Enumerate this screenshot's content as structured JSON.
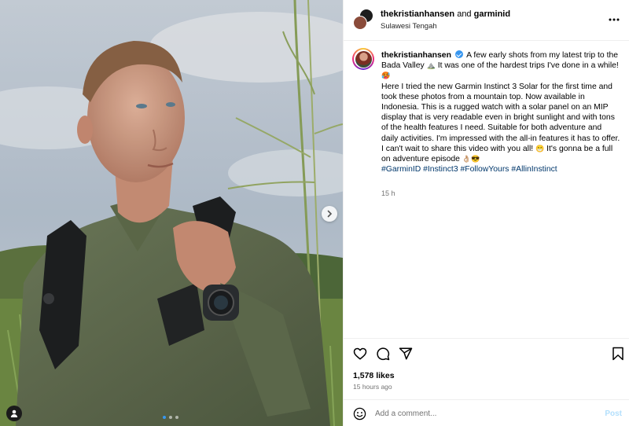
{
  "post": {
    "image_alt": "Man with a backpack wearing a Garmin Instinct 3 watch in a grassy valley",
    "carousel": {
      "count": 3,
      "active_index": 0
    }
  },
  "header": {
    "user1": "thekristianhansen",
    "connector": " and ",
    "user2": "garminid",
    "location": "Sulawesi Tengah",
    "more_icon": "more-horizontal-icon"
  },
  "caption": {
    "username": "thekristianhansen",
    "verified": true,
    "p1_a": "A few early shots from my latest trip to the Bada Valley",
    "p1_emoji1": "⛰️",
    "p1_b": "It was one of the hardest trips I've done in a while!",
    "p1_emoji2": "🥵",
    "p2": "Here I tried the new Garmin Instinct 3 Solar for the first time and took these photos from a mountain top. Now available in Indonesia. This is a rugged watch with a solar panel on an MIP display that is very readable even in bright sunlight and with tons of the health features I need. Suitable for both adventure and daily activities. I'm impressed with the all-in features it has to offer.",
    "p3_a": "I can't wait to share this video with you all!",
    "p3_emoji1": "😁",
    "p3_b": "It's gonna be a full on adventure episode",
    "p3_emoji2": "👌🏼😎",
    "hashtags": "#GarminID #Instinct3 #FollowYours #AllinInstinct",
    "time": "15 h"
  },
  "actions": {
    "like_icon": "heart-icon",
    "comment_icon": "comment-icon",
    "share_icon": "share-icon",
    "save_icon": "bookmark-icon"
  },
  "stats": {
    "likes": "1,578 likes",
    "time_ago": "15 hours ago"
  },
  "comment": {
    "placeholder": "Add a comment...",
    "post_label": "Post"
  },
  "colors": {
    "link": "#00376b",
    "verified": "#3897f0",
    "muted": "#737373",
    "post_disabled": "#b2dffc",
    "carousel_active": "#3797f0"
  }
}
